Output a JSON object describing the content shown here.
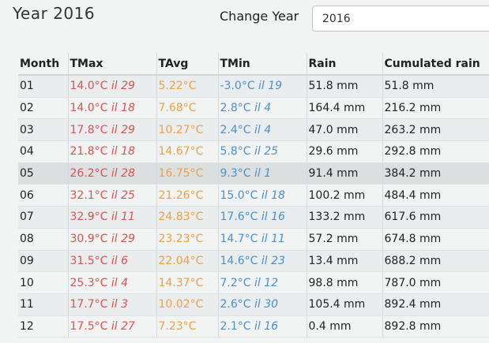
{
  "header": {
    "title": "Year 2016",
    "change_label": "Change Year",
    "year_value": "2016"
  },
  "colors": {
    "max": "#d9534f",
    "avg": "#f0a040",
    "min": "#4a90d0"
  },
  "table": {
    "columns": [
      "Month",
      "TMax",
      "TAvg",
      "TMin",
      "Rain",
      "Cumulated rain"
    ],
    "highlight_month": "05",
    "rows": [
      {
        "month": "01",
        "tmax": "14.0°C",
        "tmax_day": "il 29",
        "tavg": "5.22°C",
        "tmin": "-3.0°C",
        "tmin_day": "il 19",
        "rain": "51.8 mm",
        "cum": "51.8 mm"
      },
      {
        "month": "02",
        "tmax": "14.0°C",
        "tmax_day": "il 18",
        "tavg": "7.68°C",
        "tmin": "2.8°C",
        "tmin_day": "il 4",
        "rain": "164.4 mm",
        "cum": "216.2 mm"
      },
      {
        "month": "03",
        "tmax": "17.8°C",
        "tmax_day": "il 29",
        "tavg": "10.27°C",
        "tmin": "2.4°C",
        "tmin_day": "il 4",
        "rain": "47.0 mm",
        "cum": "263.2 mm"
      },
      {
        "month": "04",
        "tmax": "21.8°C",
        "tmax_day": "il 18",
        "tavg": "14.67°C",
        "tmin": "5.8°C",
        "tmin_day": "il 25",
        "rain": "29.6 mm",
        "cum": "292.8 mm"
      },
      {
        "month": "05",
        "tmax": "26.2°C",
        "tmax_day": "il 28",
        "tavg": "16.75°C",
        "tmin": "9.3°C",
        "tmin_day": "il 1",
        "rain": "91.4 mm",
        "cum": "384.2 mm"
      },
      {
        "month": "06",
        "tmax": "32.1°C",
        "tmax_day": "il 25",
        "tavg": "21.26°C",
        "tmin": "15.0°C",
        "tmin_day": "il 18",
        "rain": "100.2 mm",
        "cum": "484.4 mm"
      },
      {
        "month": "07",
        "tmax": "32.9°C",
        "tmax_day": "il 11",
        "tavg": "24.83°C",
        "tmin": "17.6°C",
        "tmin_day": "il 16",
        "rain": "133.2 mm",
        "cum": "617.6 mm"
      },
      {
        "month": "08",
        "tmax": "30.9°C",
        "tmax_day": "il 29",
        "tavg": "23.23°C",
        "tmin": "14.7°C",
        "tmin_day": "il 11",
        "rain": "57.2 mm",
        "cum": "674.8 mm"
      },
      {
        "month": "09",
        "tmax": "31.5°C",
        "tmax_day": "il 6",
        "tavg": "22.04°C",
        "tmin": "14.6°C",
        "tmin_day": "il 23",
        "rain": "13.4 mm",
        "cum": "688.2 mm"
      },
      {
        "month": "10",
        "tmax": "25.3°C",
        "tmax_day": "il 4",
        "tavg": "14.37°C",
        "tmin": "7.2°C",
        "tmin_day": "il 12",
        "rain": "98.8 mm",
        "cum": "787.0 mm"
      },
      {
        "month": "11",
        "tmax": "17.7°C",
        "tmax_day": "il 3",
        "tavg": "10.02°C",
        "tmin": "2.6°C",
        "tmin_day": "il 30",
        "rain": "105.4 mm",
        "cum": "892.4 mm"
      },
      {
        "month": "12",
        "tmax": "17.5°C",
        "tmax_day": "il 27",
        "tavg": "7.23°C",
        "tmin": "2.1°C",
        "tmin_day": "il 16",
        "rain": "0.4 mm",
        "cum": "892.8 mm"
      }
    ]
  }
}
